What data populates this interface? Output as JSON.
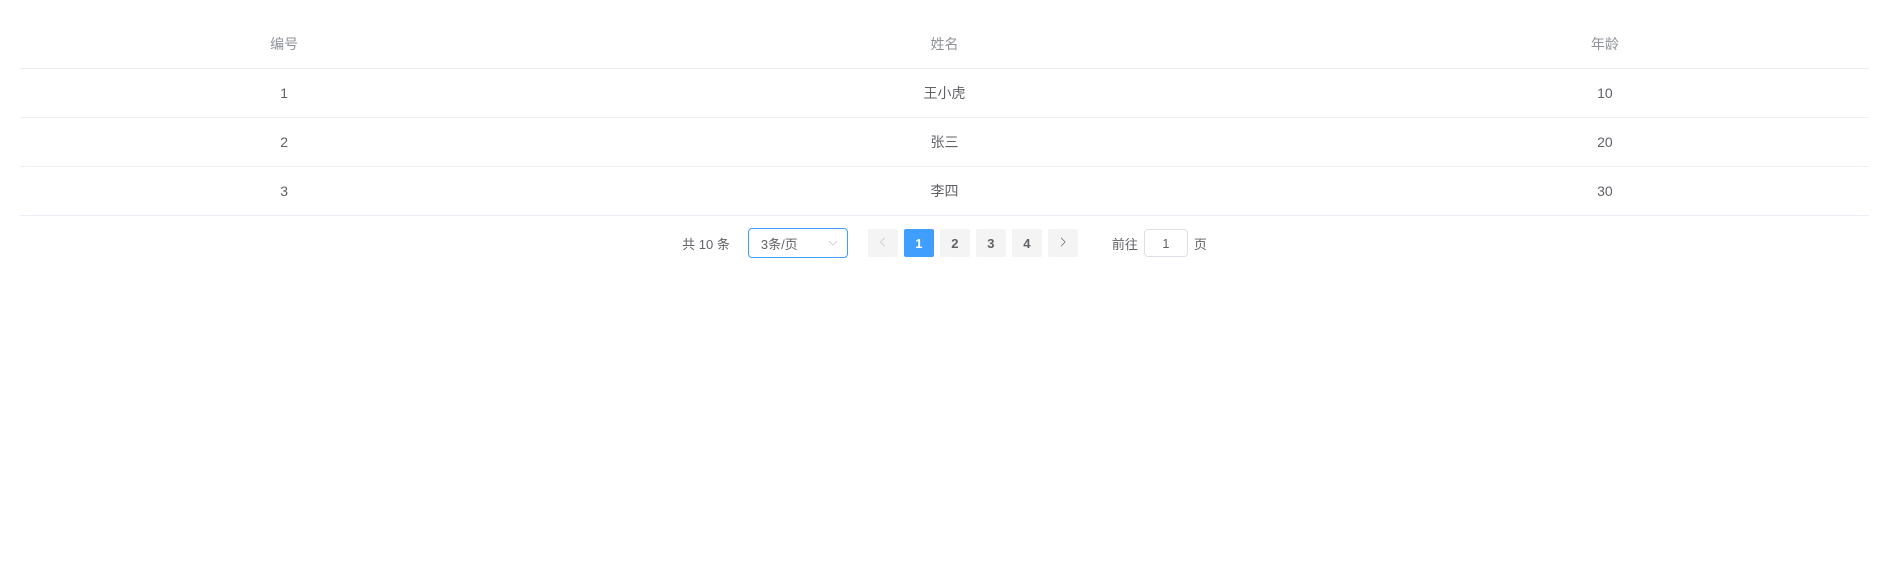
{
  "table": {
    "headers": [
      "编号",
      "姓名",
      "年龄"
    ],
    "rows": [
      {
        "id": "1",
        "name": "王小虎",
        "age": "10"
      },
      {
        "id": "2",
        "name": "张三",
        "age": "20"
      },
      {
        "id": "3",
        "name": "李四",
        "age": "30"
      }
    ]
  },
  "pagination": {
    "total_prefix": "共 ",
    "total_count": "10",
    "total_suffix": " 条",
    "page_size_label": "3条/页",
    "pages": [
      "1",
      "2",
      "3",
      "4"
    ],
    "active_page": "1",
    "jumper_prefix": "前往",
    "jumper_value": "1",
    "jumper_suffix": "页"
  }
}
